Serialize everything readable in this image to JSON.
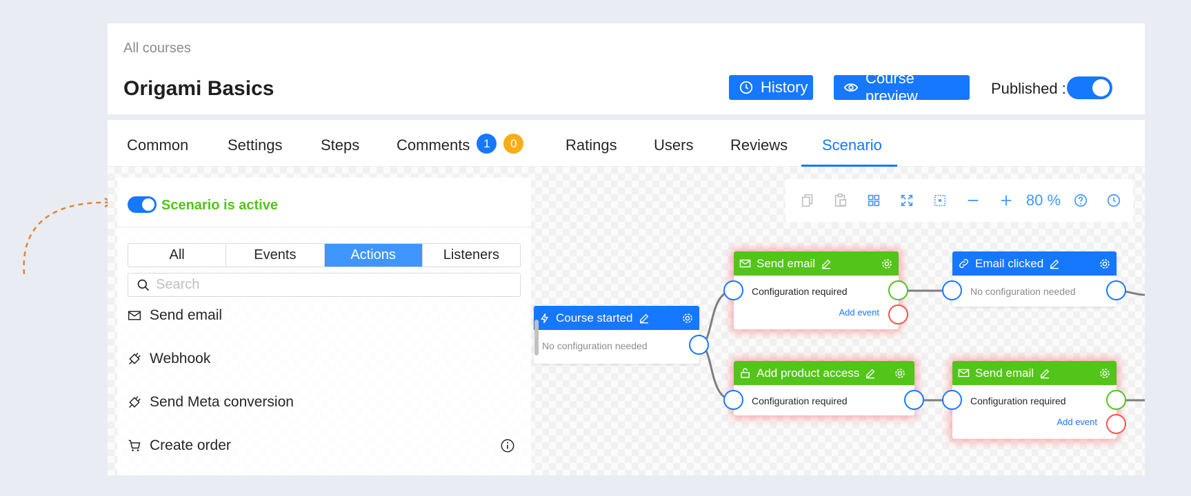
{
  "header": {
    "breadcrumb": "All courses",
    "title": "Origami Basics",
    "history_label": "History",
    "preview_label": "Course preview",
    "published_label": "Published :",
    "published": true
  },
  "tabs": [
    {
      "label": "Common"
    },
    {
      "label": "Settings"
    },
    {
      "label": "Steps"
    },
    {
      "label": "Comments",
      "badges": [
        "1",
        "0"
      ]
    },
    {
      "label": "Ratings"
    },
    {
      "label": "Users"
    },
    {
      "label": "Reviews"
    },
    {
      "label": "Scenario",
      "active": true
    }
  ],
  "panel": {
    "scenario_label": "Scenario is active",
    "scenario_active": true,
    "filters": [
      "All",
      "Events",
      "Actions",
      "Listeners"
    ],
    "active_filter": "Actions",
    "search_placeholder": "Search",
    "items": [
      {
        "label": "Send email",
        "icon": "mail-icon"
      },
      {
        "label": "Webhook",
        "icon": "plug-icon"
      },
      {
        "label": "Send Meta conversion",
        "icon": "plug-icon"
      },
      {
        "label": "Create order",
        "icon": "cart-icon"
      }
    ]
  },
  "toolbar": {
    "zoom": "80 %",
    "tools": [
      "copy-icon",
      "paste-icon",
      "grid-icon",
      "fit-icon",
      "select-icon",
      "zoom-out-icon",
      "zoom-in-icon",
      "help-icon",
      "history-icon"
    ]
  },
  "nodes": {
    "course_started": {
      "title": "Course started",
      "body": "No configuration needed"
    },
    "send_email_1": {
      "title": "Send email",
      "body": "Configuration required",
      "add_event": "Add event"
    },
    "email_clicked": {
      "title": "Email clicked",
      "body": "No configuration needed"
    },
    "add_product_access": {
      "title": "Add product access",
      "body": "Configuration required"
    },
    "send_email_2": {
      "title": "Send email",
      "body": "Configuration required",
      "add_event": "Add event"
    }
  },
  "colors": {
    "primary": "#1677ff",
    "success": "#52c41a",
    "warning": "#faad14",
    "error": "#ff4d4f",
    "annotation_arrow": "#e8812e"
  }
}
